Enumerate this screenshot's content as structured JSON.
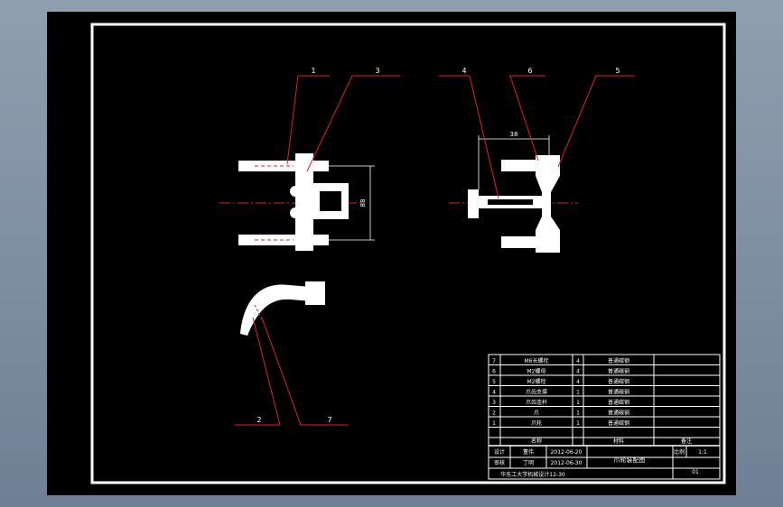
{
  "balloons": [
    "1",
    "3",
    "4",
    "6",
    "5",
    "2",
    "7"
  ],
  "dimensions": {
    "horizontal": "38",
    "vertical": "88"
  },
  "title_block": {
    "parts": [
      {
        "no": "7",
        "name": "M6长螺栓",
        "qty": "4",
        "material": "普通碳钢"
      },
      {
        "no": "6",
        "name": "M2螺母",
        "qty": "4",
        "material": "普通碳钢"
      },
      {
        "no": "5",
        "name": "M2螺栓",
        "qty": "4",
        "material": "普通碳钢"
      },
      {
        "no": "4",
        "name": "爪齿支撑",
        "qty": "1",
        "material": "普通碳钢"
      },
      {
        "no": "3",
        "name": "爪齿连杆",
        "qty": "1",
        "material": "普通碳钢"
      },
      {
        "no": "2",
        "name": "爪",
        "qty": "1",
        "material": "普通碳钢"
      },
      {
        "no": "1",
        "name": "爪轮",
        "qty": "1",
        "material": "普通碳钢"
      }
    ],
    "header": {
      "name": "名称",
      "material": "材料",
      "note": "备注"
    },
    "designer_label": "设计",
    "designer": "董伟",
    "design_date": "2012-06-20",
    "checker_label": "审核",
    "checker": "丁明",
    "check_date": "2012-06-30",
    "drawing_title": "爪轮装配图",
    "scale_label": "比例",
    "scale": "1:1",
    "sheet": "01",
    "school": "华东工大学机械设计12-30"
  }
}
